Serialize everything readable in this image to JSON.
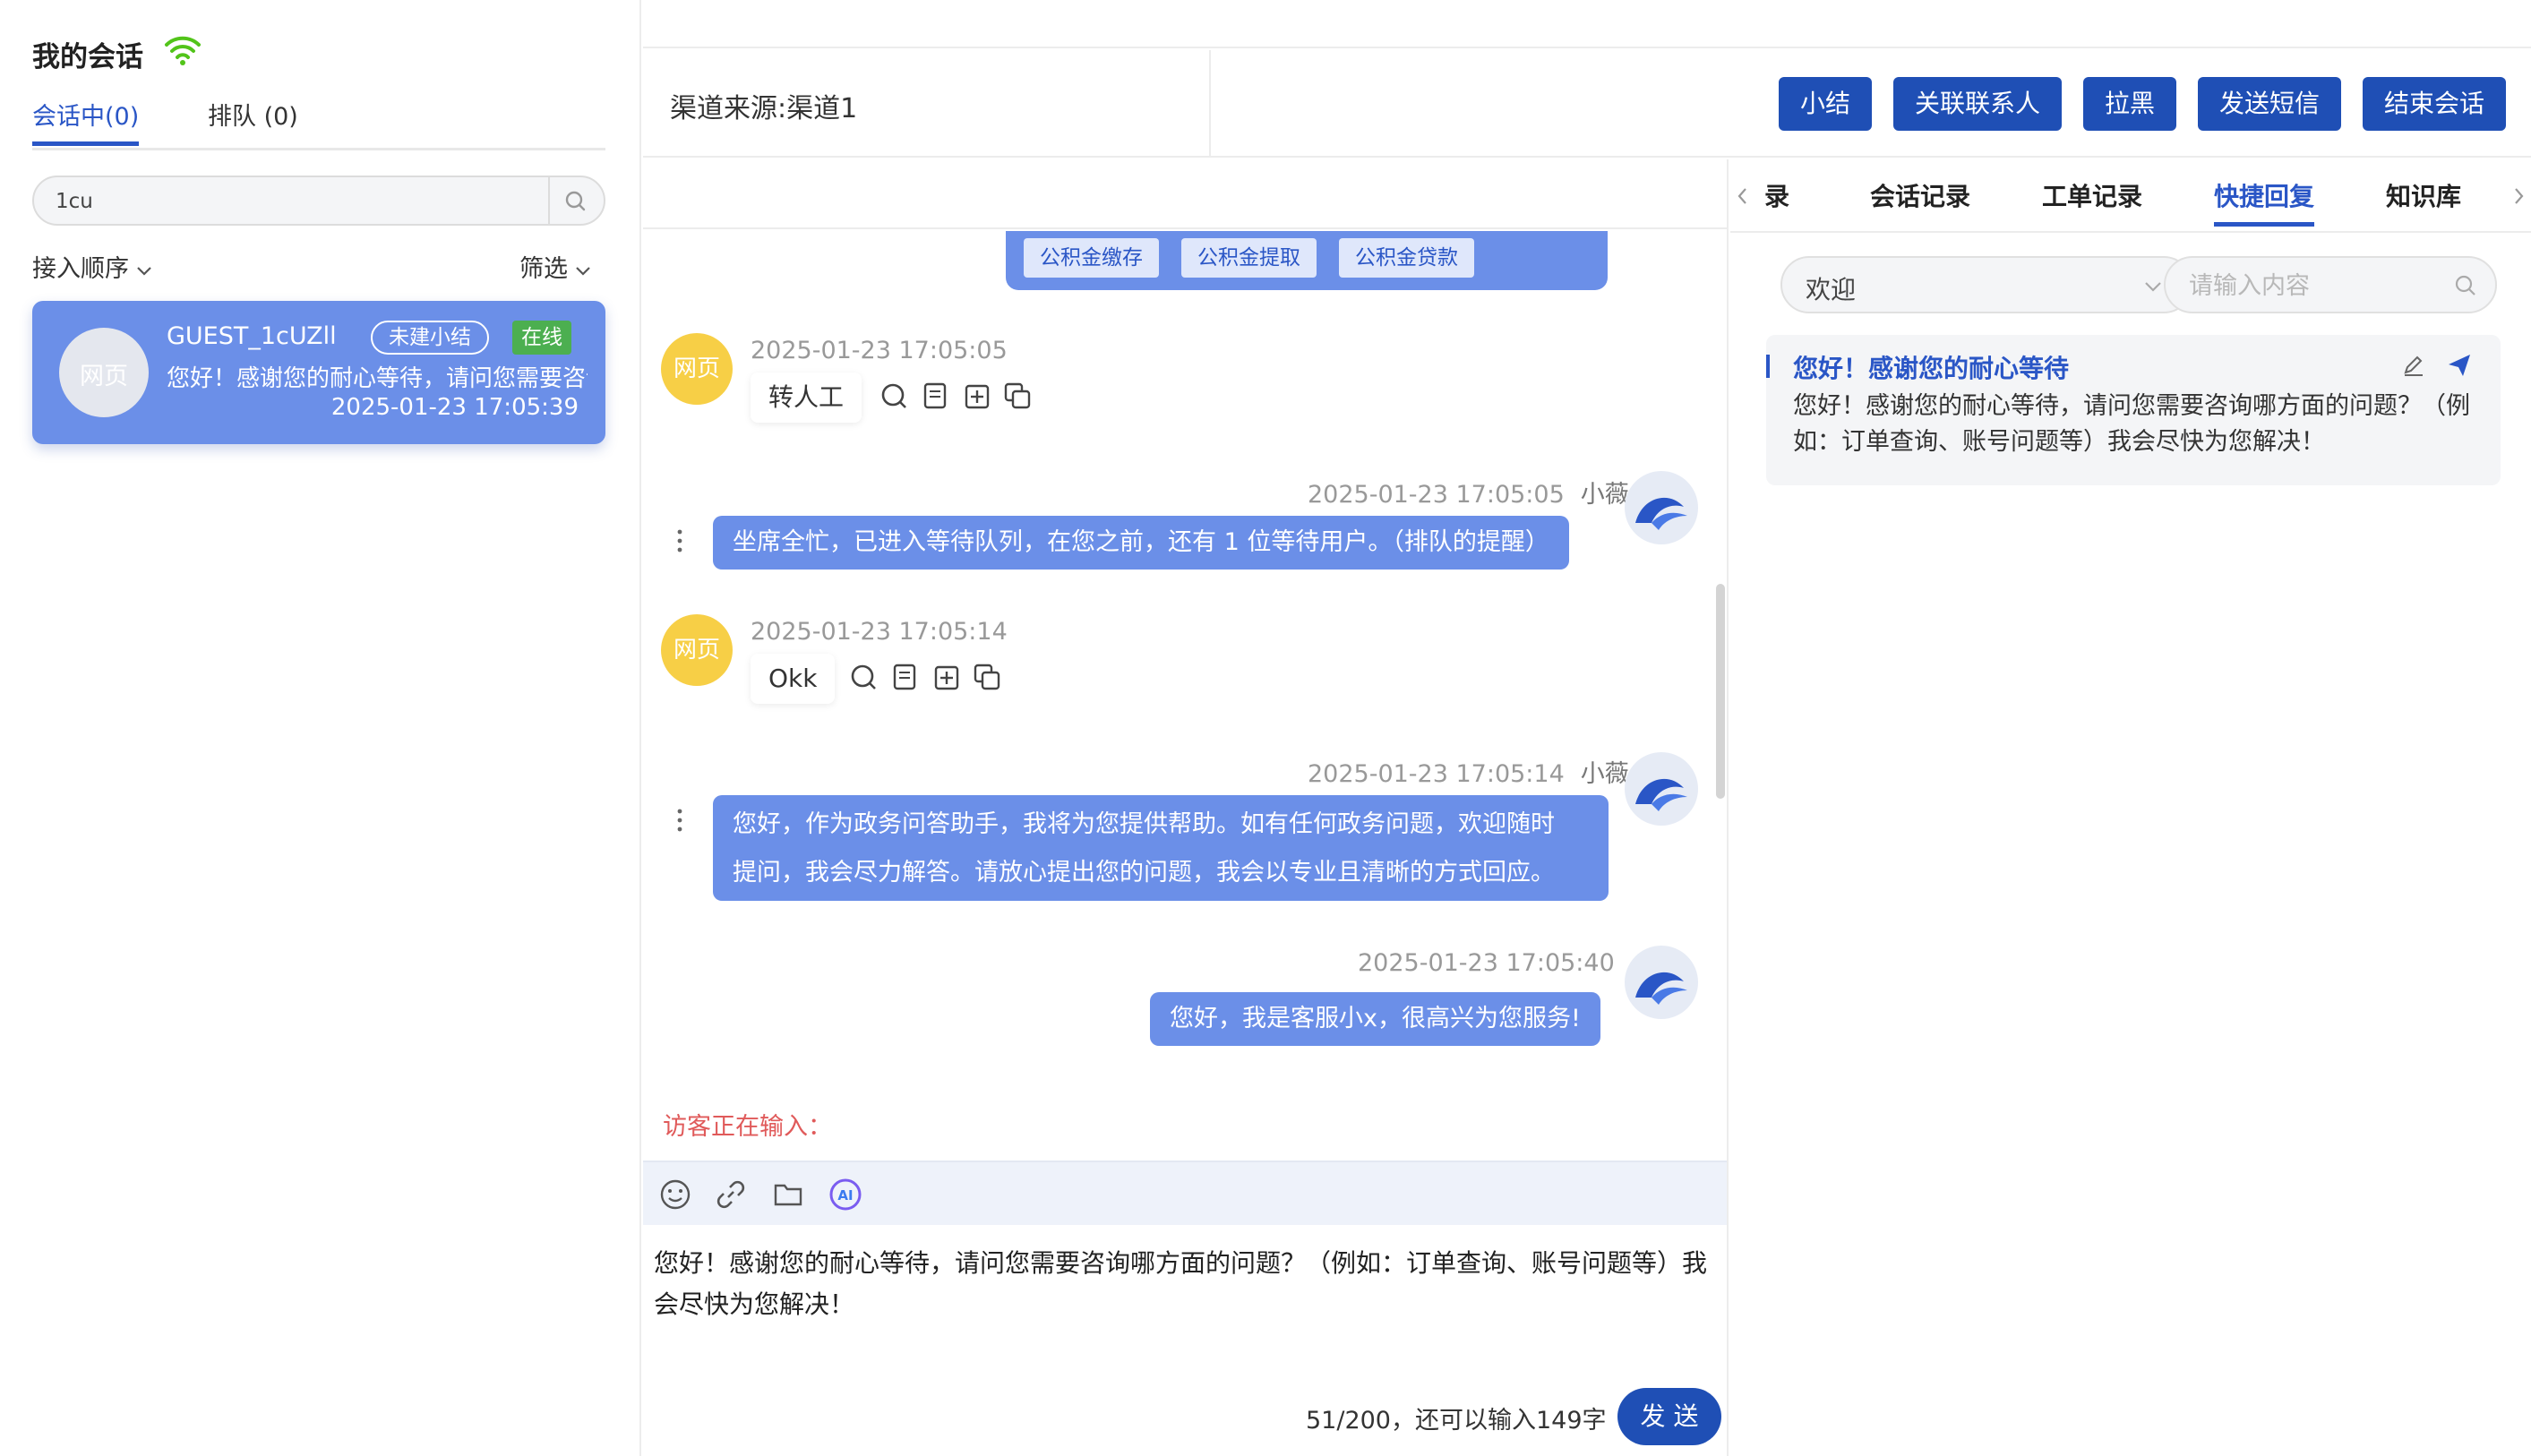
{
  "left": {
    "title": "我的会话",
    "tabs": [
      {
        "label": "会话中(0)",
        "active": true
      },
      {
        "label": "排队 (0)",
        "active": false
      }
    ],
    "search_value": "1cu",
    "order_label": "接入顺序",
    "filter_label": "筛选",
    "session": {
      "avatar_text": "网页",
      "name": "GUEST_1cUZll",
      "badge_summary": "未建小结",
      "badge_status": "在线",
      "preview": "您好！感谢您的耐心等待，请问您需要咨询哪方面的问题？",
      "time": "2025-01-23 17:05:39"
    }
  },
  "header": {
    "channel": "渠道来源:渠道1",
    "buttons": [
      "小结",
      "关联联系人",
      "拉黑",
      "发送短信",
      "结束会话"
    ]
  },
  "chat": {
    "quick_chips": [
      "公积金缴存",
      "公积金提取",
      "公积金贷款"
    ],
    "messages": [
      {
        "side": "left",
        "avatar": "网页",
        "time": "2025-01-23 17:05:05",
        "text": "转人工"
      },
      {
        "side": "right",
        "time": "2025-01-23 17:05:05",
        "sender": "小薇",
        "text": "坐席全忙，已进入等待队列，在您之前，还有 1 位等待用户。（排队的提醒）"
      },
      {
        "side": "left",
        "avatar": "网页",
        "time": "2025-01-23 17:05:14",
        "text": "Okk"
      },
      {
        "side": "right",
        "time": "2025-01-23 17:05:14",
        "sender": "小薇",
        "text_line1": "您好，作为政务问答助手，我将为您提供帮助。如有任何政务问题，欢迎随时",
        "text_line2": "提问，我会尽力解答。请放心提出您的问题，我会以专业且清晰的方式回应。"
      },
      {
        "side": "right",
        "time": "2025-01-23 17:05:40",
        "text": "您好，我是客服小x，很高兴为您服务!"
      }
    ],
    "typing": "访客正在输入：",
    "composer_text": "您好！感谢您的耐心等待，请问您需要咨询哪方面的问题？（例如：订单查询、账号问题等）我会尽快为您解决！",
    "counter": "51/200，还可以输入149字",
    "send_label": "发 送"
  },
  "right": {
    "tabs": [
      {
        "label": "录",
        "active": false
      },
      {
        "label": "会话记录",
        "active": false
      },
      {
        "label": "工单记录",
        "active": false
      },
      {
        "label": "快捷回复",
        "active": true
      },
      {
        "label": "知识库",
        "active": false
      }
    ],
    "category": "欢迎",
    "search_placeholder": "请输入内容",
    "reply": {
      "title": "您好！感谢您的耐心等待",
      "body": "您好！感谢您的耐心等待，请问您需要咨询哪方面的问题？（例如：订单查询、账号问题等）我会尽快为您解决！"
    }
  },
  "colors": {
    "accent": "#1f4fb5",
    "bubble": "#6b8fe8",
    "web_avatar": "#f7cf46",
    "online": "#4caf50",
    "typing": "#e05a5a"
  },
  "icons": [
    "wifi-icon",
    "search-icon",
    "chevron-down-icon",
    "smile-icon",
    "link-icon",
    "folder-icon",
    "ai-icon",
    "edit-icon",
    "send-icon",
    "copy-icon",
    "note-icon"
  ]
}
